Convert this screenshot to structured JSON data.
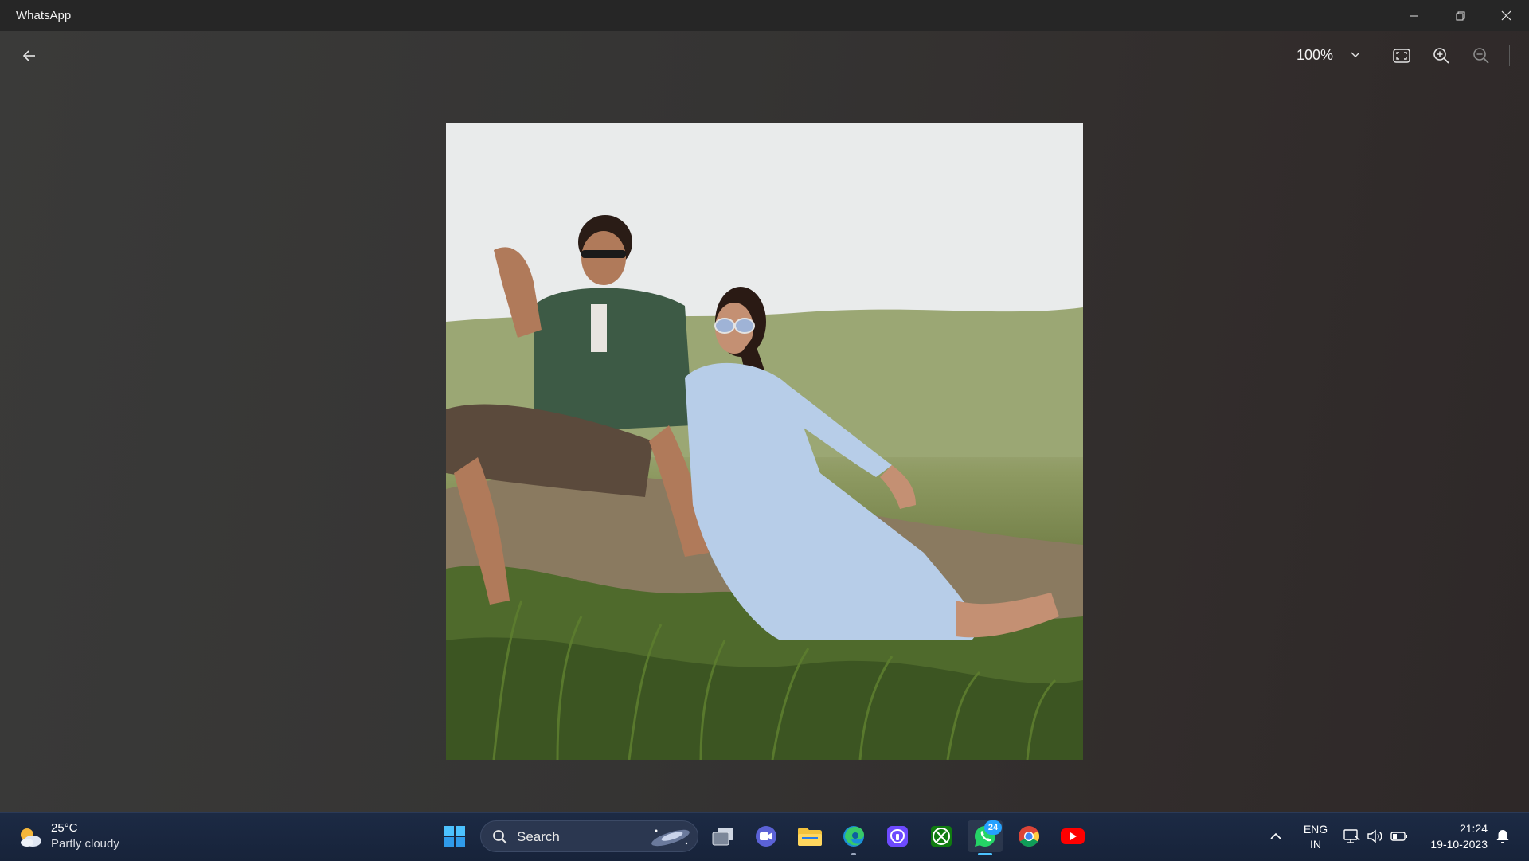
{
  "window": {
    "title": "WhatsApp"
  },
  "viewer": {
    "zoom_level": "100%",
    "image_alt": "Couple sitting in grass"
  },
  "taskbar": {
    "weather": {
      "temperature": "25°C",
      "condition": "Partly cloudy"
    },
    "search": {
      "placeholder": "Search"
    },
    "apps": [
      {
        "name": "Task view"
      },
      {
        "name": "Teams meeting"
      },
      {
        "name": "File Explorer"
      },
      {
        "name": "Microsoft Edge"
      },
      {
        "name": "Proton Pass"
      },
      {
        "name": "Xbox"
      },
      {
        "name": "WhatsApp",
        "badge": "24"
      },
      {
        "name": "Google Chrome"
      },
      {
        "name": "YouTube"
      }
    ],
    "tray": {
      "language_line1": "ENG",
      "language_line2": "IN",
      "time": "21:24",
      "date": "19-10-2023"
    }
  },
  "colors": {
    "accent": "#25a1ff",
    "whatsapp": "#25d366",
    "youtube": "#ff0000"
  }
}
